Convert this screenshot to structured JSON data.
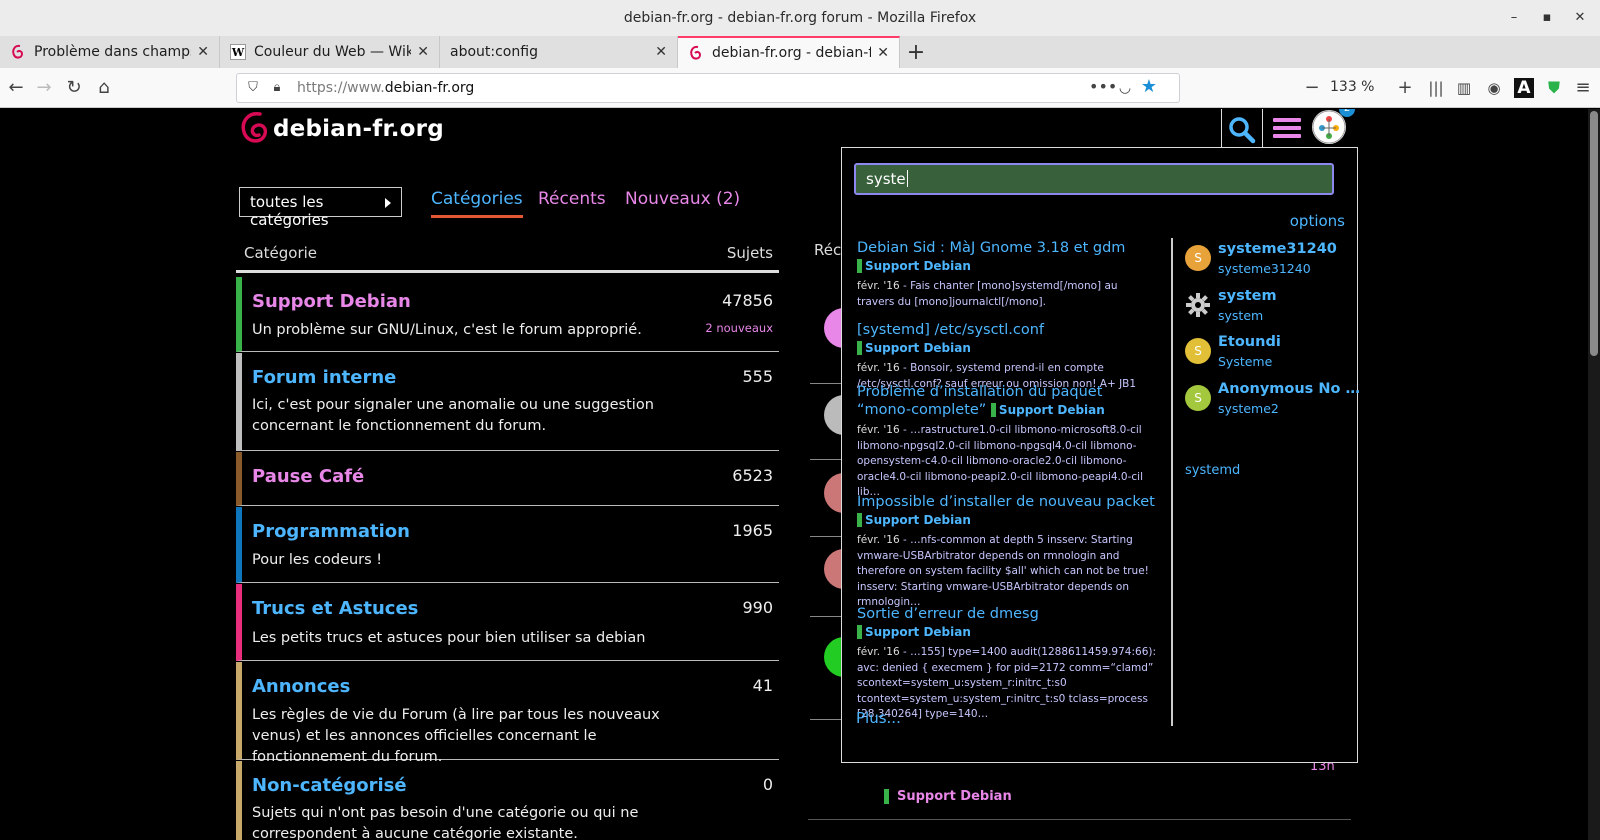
{
  "window": {
    "title": "debian-fr.org - debian-fr.org forum - Mozilla Firefox"
  },
  "tabs": [
    {
      "label": "Problème dans champs s",
      "icon": "debian-swirl-icon"
    },
    {
      "label": "Couleur du Web — Wikip",
      "icon": "wikipedia-icon"
    },
    {
      "label": "about:config",
      "icon": ""
    },
    {
      "label": "debian-fr.org - debian-fr",
      "icon": "debian-swirl-icon"
    }
  ],
  "navbar": {
    "url_prefix": "https://www.",
    "url_domain": "debian-fr.org",
    "zoom": "133 %"
  },
  "site": {
    "logo_text": "debian-fr.org",
    "notif_count": "2"
  },
  "nav": {
    "category_dropdown": "toutes les catégories",
    "pills": [
      "Catégories",
      "Récents",
      "Nouveaux (2)"
    ]
  },
  "table": {
    "col_category": "Catégorie",
    "col_topics": "Sujets",
    "latest_header": "Réce"
  },
  "categories": [
    {
      "name": "Support Debian",
      "desc": "Un problème sur GNU/Linux, c'est le forum approprié.",
      "count": "47856",
      "new": "2 nouveaux",
      "color": "#3ab24a"
    },
    {
      "name": "Forum interne",
      "desc": "Ici, c'est pour signaler une anomalie ou une suggestion concernant le fonctionnement du forum.",
      "count": "555",
      "color": "#bfbfbf"
    },
    {
      "name": "Pause Café",
      "desc": "",
      "count": "6523",
      "color": "#8b5a2b"
    },
    {
      "name": "Programmation",
      "desc": "Pour les codeurs !",
      "count": "1965",
      "color": "#0e76bd"
    },
    {
      "name": "Trucs et Astuces",
      "desc": "Les petits trucs et astuces pour bien utiliser sa debian",
      "count": "990",
      "color": "#e92e7e"
    },
    {
      "name": "Annonces",
      "desc": "Les règles de vie du Forum (à lire par tous les nouveaux venus) et les annonces officielles concernant le fonctionnement du forum.",
      "count": "41",
      "color": "#c8a96a"
    },
    {
      "name": "Non-catégorisé",
      "desc": "Sujets qui n'ont pas besoin d'une catégorie ou qui ne correspondent à aucune catégorie existante.",
      "count": "0",
      "color": "#c8a96a"
    }
  ],
  "latest": {
    "bottom_category": "Support Debian",
    "bottom_time": "13h"
  },
  "search": {
    "query": "syste",
    "options_label": "options",
    "more_label": "Plus...",
    "results": [
      {
        "title": "Debian Sid : MàJ Gnome 3.18 et gdm",
        "category": "Support Debian",
        "date": "févr. '16",
        "blurb": " - Fais chanter [mono]systemd[/mono] au travers du [mono]journalctl[/mono]."
      },
      {
        "title": "[systemd] /etc/sysctl.conf",
        "category": "Support Debian",
        "date": "févr. '16",
        "blurb": " - Bonsoir, systemd prend-il en compte /etc/sysctl.conf? sauf erreur ou omission non! A+ JB1"
      },
      {
        "title": "Problème d’installation du paquet “mono-complete”",
        "category": "Support Debian",
        "date": "févr. '16",
        "blurb": " - …rastructure1.0-cil libmono-microsoft8.0-cil libmono-npgsql2.0-cil libmono-npgsql4.0-cil libmono-opensystem-c4.0-cil libmono-oracle2.0-cil libmono-oracle4.0-cil libmono-peapi2.0-cil libmono-peapi4.0-cil lib…"
      },
      {
        "title": "Impossible d’installer de nouveau packet",
        "category": "Support Debian",
        "date": "févr. '16",
        "blurb": " - …nfs-common at depth 5 insserv: Starting vmware-USBArbitrator depends on rmnologin and therefore on system facility $all' which can not be true! insserv: Starting vmware-USBArbitrator depends on rmnologin…"
      },
      {
        "title": "Sortie d’erreur de dmesg",
        "category": "Support Debian",
        "date": "févr. '16",
        "blurb": " - …155] type=1400 audit(1288611459.974:66): avc: denied { execmem } for pid=2172 comm=“clamd” scontext=system_u:system_r:initrc_t:s0 tcontext=system_u:system_r:initrc_t:s0 tclass=process [28.340264] type=140…"
      }
    ],
    "users": [
      {
        "name": "systeme31240",
        "handle": "systeme31240",
        "initial": "S",
        "color": "#e7a33a"
      },
      {
        "name": "system",
        "handle": "system",
        "initial": "",
        "color": "#000000",
        "icon": "gear-icon"
      },
      {
        "name": "Etoundi",
        "handle": "Systeme",
        "initial": "S",
        "color": "#e1bf36"
      },
      {
        "name": "Anonymous No …",
        "handle": "systeme2",
        "initial": "S",
        "color": "#a4c83d"
      }
    ],
    "tag": "systemd"
  }
}
